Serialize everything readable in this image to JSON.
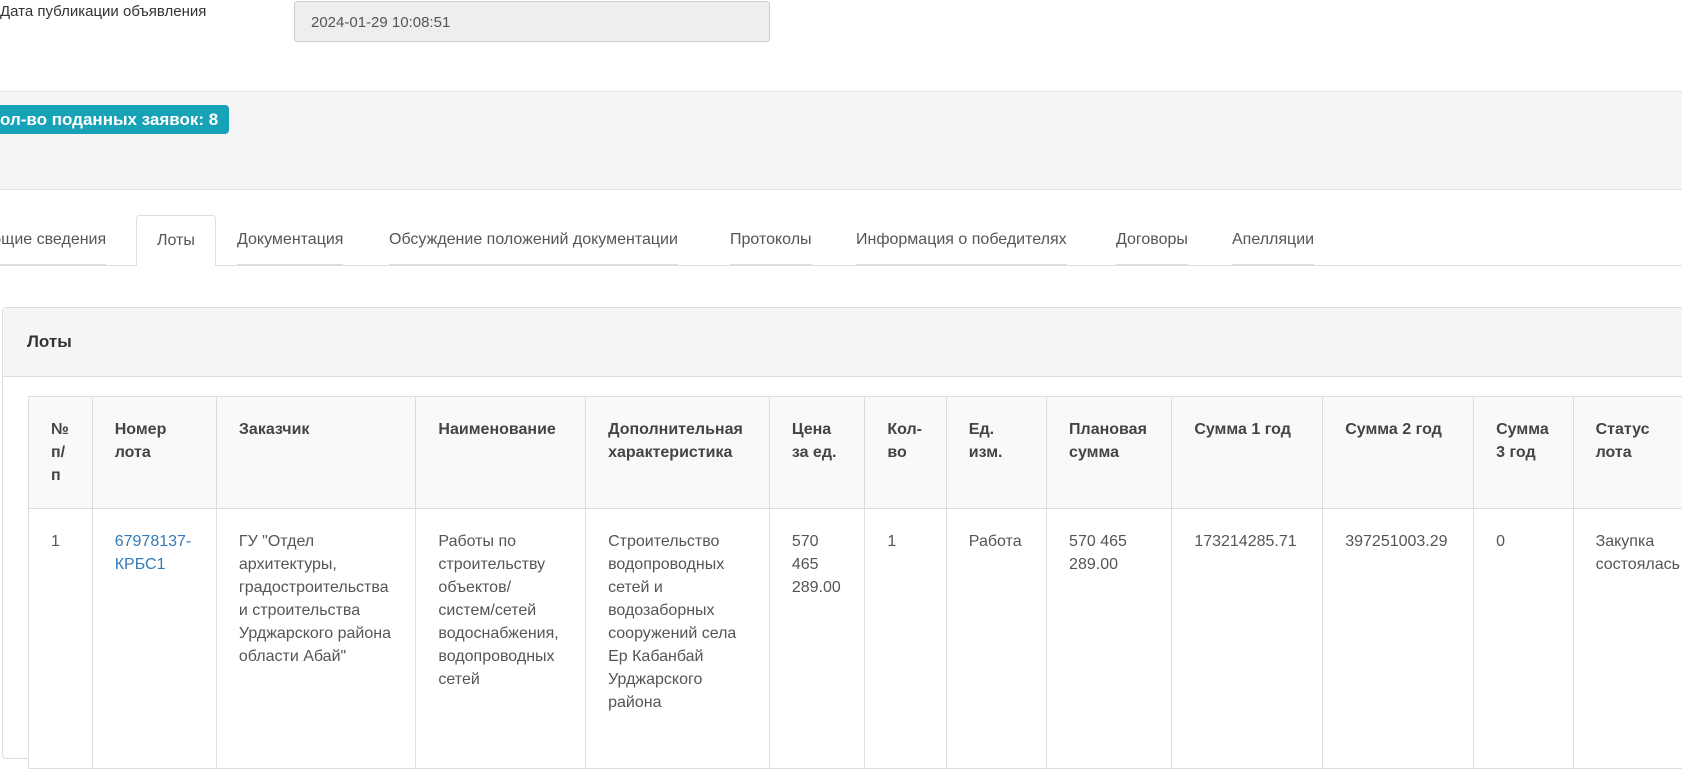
{
  "publication": {
    "label": "Дата публикации объявления",
    "value": "2024-01-29 10:08:51"
  },
  "bids_badge": "ол-во поданных заявок: 8",
  "tabs": [
    {
      "label": "бщие сведения"
    },
    {
      "label": "Лоты"
    },
    {
      "label": "Документация"
    },
    {
      "label": "Обсуждение положений документации"
    },
    {
      "label": "Протоколы"
    },
    {
      "label": "Информация о победителях"
    },
    {
      "label": "Договоры"
    },
    {
      "label": "Апелляции"
    }
  ],
  "active_tab": "Лоты",
  "panel": {
    "title": "Лоты"
  },
  "table": {
    "headers": [
      "№ п/п",
      "Номер лота",
      "Заказчик",
      "Наименование",
      "Дополнительная характеристика",
      "Цена за ед.",
      "Кол-во",
      "Ед. изм.",
      "Плановая сумма",
      "Сумма 1 год",
      "Сумма 2 год",
      "Сумма 3 год",
      "Статус лота"
    ],
    "rows": [
      {
        "num": "1",
        "lot": "67978137-КРБС1",
        "customer": "ГУ \"Отдел архитектуры, градостроительства и строительства Урджарского района области Абай\"",
        "name": "Работы по строительству объектов/систем/сетей водоснабжения, водопроводных сетей",
        "extra": "Строительство водопроводных сетей и водозаборных сооружений села Ер Кабанбай Урджарского района",
        "price": "570 465 289.00",
        "qty": "1",
        "unit": "Работа",
        "planned": "570 465 289.00",
        "sum1": "173214285.71",
        "sum2": "397251003.29",
        "sum3": "0",
        "status": "Закупка состоялась"
      }
    ]
  },
  "colors": {
    "badge": "#17a2b8",
    "link": "#337ab7"
  }
}
